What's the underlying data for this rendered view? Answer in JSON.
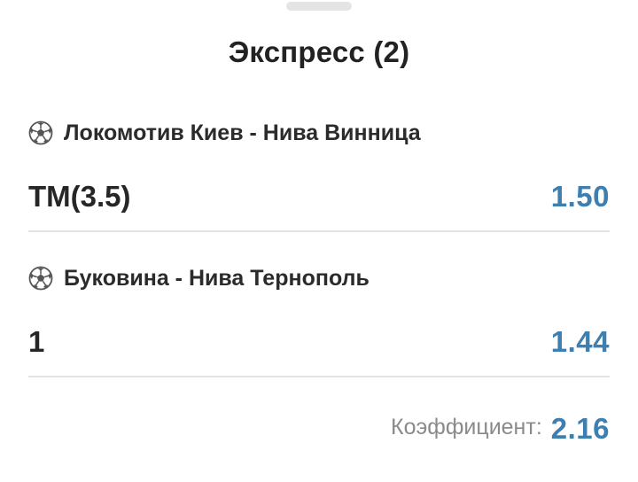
{
  "header": {
    "title": "Экспресс (2)"
  },
  "events": [
    {
      "sport_icon": "soccer-ball-icon",
      "match": "Локомотив Киев - Нива Винница",
      "market": "ТМ(3.5)",
      "odds": "1.50"
    },
    {
      "sport_icon": "soccer-ball-icon",
      "match": "Буковина - Нива Тернополь",
      "market": "1",
      "odds": "1.44"
    }
  ],
  "summary": {
    "label": "Коэффициент:",
    "value": "2.16"
  },
  "colors": {
    "accent": "#3d7fb0",
    "text": "#262626",
    "muted": "#8a8a8a",
    "divider": "#e3e3e3"
  }
}
